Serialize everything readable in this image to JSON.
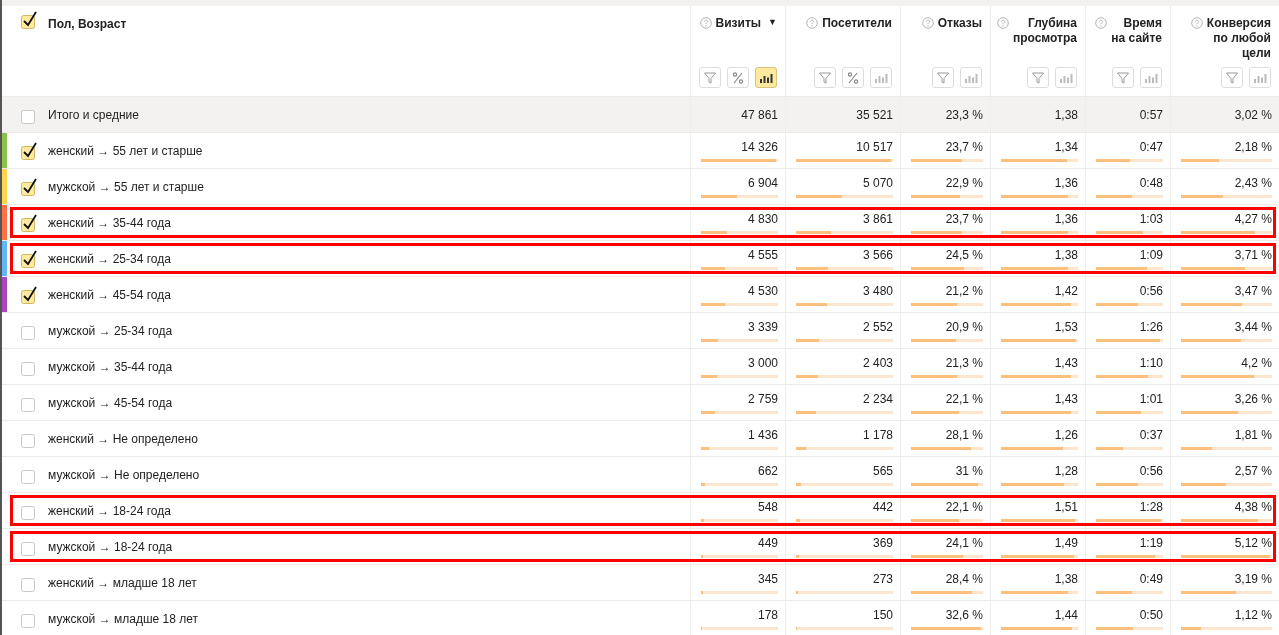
{
  "dimension": {
    "label": "Пол, Возраст",
    "checked": true
  },
  "columns": [
    {
      "title": "Визиты",
      "sort": "▼",
      "tools": [
        {
          "kind": "filter",
          "selected": false
        },
        {
          "kind": "percent",
          "selected": false
        },
        {
          "kind": "bars",
          "selected": true
        }
      ]
    },
    {
      "title": "Посетители",
      "tools": [
        {
          "kind": "filter",
          "selected": false
        },
        {
          "kind": "percent",
          "selected": false
        },
        {
          "kind": "bars",
          "selected": false
        }
      ]
    },
    {
      "title": "Отказы",
      "tools": [
        {
          "kind": "filter",
          "selected": false
        },
        {
          "kind": "bars",
          "selected": false
        }
      ]
    },
    {
      "title": "Глубина\nпросмотра",
      "tools": [
        {
          "kind": "filter",
          "selected": false
        },
        {
          "kind": "bars",
          "selected": false
        }
      ]
    },
    {
      "title": "Время\nна сайте",
      "tools": [
        {
          "kind": "filter",
          "selected": false
        },
        {
          "kind": "bars",
          "selected": false
        }
      ]
    },
    {
      "title": "Конверсия\nпо любой\nцели",
      "tools": [
        {
          "kind": "filter",
          "selected": false
        },
        {
          "kind": "bars",
          "selected": false
        }
      ]
    }
  ],
  "total": {
    "label": "Итого и средние",
    "checked": false,
    "values": [
      "47 861",
      "35 521",
      "23,3 %",
      "1,38",
      "0:57",
      "3,02 %"
    ]
  },
  "rows": [
    {
      "label": "женский → 55 лет и старше",
      "checked": true,
      "color": "#8bc34a",
      "highlighted": false,
      "cells": [
        {
          "value": "14 326",
          "level": 1
        },
        {
          "value": "10 517",
          "level": 1
        },
        {
          "value": "23,7 %",
          "level": 0.73
        },
        {
          "value": "1,34",
          "level": 0.88
        },
        {
          "value": "0:47",
          "level": 0.53
        },
        {
          "value": "2,18 %",
          "level": 0.43
        }
      ]
    },
    {
      "label": "мужской → 55 лет и старше",
      "checked": true,
      "color": "#ffd54f",
      "highlighted": false,
      "cells": [
        {
          "value": "6 904",
          "level": 0.48
        },
        {
          "value": "5 070",
          "level": 0.48
        },
        {
          "value": "22,9 %",
          "level": 0.7
        },
        {
          "value": "1,36",
          "level": 0.89
        },
        {
          "value": "0:48",
          "level": 0.55
        },
        {
          "value": "2,43 %",
          "level": 0.47
        }
      ]
    },
    {
      "label": "женский → 35-44 года",
      "checked": true,
      "color": "#ff7043",
      "highlighted": true,
      "cells": [
        {
          "value": "4 830",
          "level": 0.34
        },
        {
          "value": "3 861",
          "level": 0.37
        },
        {
          "value": "23,7 %",
          "level": 0.73
        },
        {
          "value": "1,36",
          "level": 0.89
        },
        {
          "value": "1:03",
          "level": 0.72
        },
        {
          "value": "4,27 %",
          "level": 0.83
        }
      ]
    },
    {
      "label": "женский → 25-34 года",
      "checked": true,
      "color": "#64b5f6",
      "highlighted": true,
      "cells": [
        {
          "value": "4 555",
          "level": 0.32
        },
        {
          "value": "3 566",
          "level": 0.34
        },
        {
          "value": "24,5 %",
          "level": 0.75
        },
        {
          "value": "1,38",
          "level": 0.9
        },
        {
          "value": "1:09",
          "level": 0.78
        },
        {
          "value": "3,71 %",
          "level": 0.72
        }
      ]
    },
    {
      "label": "женский → 45-54 года",
      "checked": true,
      "color": "#ab47bc",
      "highlighted": false,
      "cells": [
        {
          "value": "4 530",
          "level": 0.32
        },
        {
          "value": "3 480",
          "level": 0.33
        },
        {
          "value": "21,2 %",
          "level": 0.65
        },
        {
          "value": "1,42",
          "level": 0.93
        },
        {
          "value": "0:56",
          "level": 0.64
        },
        {
          "value": "3,47 %",
          "level": 0.68
        }
      ]
    },
    {
      "label": "мужской → 25-34 года",
      "checked": false,
      "highlighted": false,
      "cells": [
        {
          "value": "3 339",
          "level": 0.23
        },
        {
          "value": "2 552",
          "level": 0.24
        },
        {
          "value": "20,9 %",
          "level": 0.64
        },
        {
          "value": "1,53",
          "level": 1
        },
        {
          "value": "1:26",
          "level": 0.98
        },
        {
          "value": "3,44 %",
          "level": 0.67
        }
      ]
    },
    {
      "label": "мужской → 35-44 года",
      "checked": false,
      "highlighted": false,
      "cells": [
        {
          "value": "3 000",
          "level": 0.21
        },
        {
          "value": "2 403",
          "level": 0.23
        },
        {
          "value": "21,3 %",
          "level": 0.65
        },
        {
          "value": "1,43",
          "level": 0.93
        },
        {
          "value": "1:10",
          "level": 0.8
        },
        {
          "value": "4,2 %",
          "level": 0.82
        }
      ]
    },
    {
      "label": "мужской → 45-54 года",
      "checked": false,
      "highlighted": false,
      "cells": [
        {
          "value": "2 759",
          "level": 0.19
        },
        {
          "value": "2 234",
          "level": 0.21
        },
        {
          "value": "22,1 %",
          "level": 0.68
        },
        {
          "value": "1,43",
          "level": 0.93
        },
        {
          "value": "1:01",
          "level": 0.69
        },
        {
          "value": "3,26 %",
          "level": 0.64
        }
      ]
    },
    {
      "label": "женский → Не определено",
      "checked": false,
      "highlighted": false,
      "cells": [
        {
          "value": "1 436",
          "level": 0.1
        },
        {
          "value": "1 178",
          "level": 0.11
        },
        {
          "value": "28,1 %",
          "level": 0.86
        },
        {
          "value": "1,26",
          "level": 0.82
        },
        {
          "value": "0:37",
          "level": 0.42
        },
        {
          "value": "1,81 %",
          "level": 0.35
        }
      ]
    },
    {
      "label": "мужской → Не определено",
      "checked": false,
      "highlighted": false,
      "cells": [
        {
          "value": "662",
          "level": 0.05
        },
        {
          "value": "565",
          "level": 0.05
        },
        {
          "value": "31 %",
          "level": 0.95
        },
        {
          "value": "1,28",
          "level": 0.84
        },
        {
          "value": "0:56",
          "level": 0.64
        },
        {
          "value": "2,57 %",
          "level": 0.5
        }
      ]
    },
    {
      "label": "женский → 18-24 года",
      "checked": false,
      "highlighted": true,
      "cells": [
        {
          "value": "548",
          "level": 0.04
        },
        {
          "value": "442",
          "level": 0.04
        },
        {
          "value": "22,1 %",
          "level": 0.68
        },
        {
          "value": "1,51",
          "level": 0.99
        },
        {
          "value": "1:28",
          "level": 1
        },
        {
          "value": "4,38 %",
          "level": 0.86
        }
      ]
    },
    {
      "label": "мужской → 18-24 года",
      "checked": false,
      "highlighted": true,
      "cells": [
        {
          "value": "449",
          "level": 0.03
        },
        {
          "value": "369",
          "level": 0.035
        },
        {
          "value": "24,1 %",
          "level": 0.74
        },
        {
          "value": "1,49",
          "level": 0.97
        },
        {
          "value": "1:19",
          "level": 0.9
        },
        {
          "value": "5,12 %",
          "level": 1
        }
      ]
    },
    {
      "label": "женский → младше 18 лет",
      "checked": false,
      "highlighted": false,
      "cells": [
        {
          "value": "345",
          "level": 0.02
        },
        {
          "value": "273",
          "level": 0.026
        },
        {
          "value": "28,4 %",
          "level": 0.87
        },
        {
          "value": "1,38",
          "level": 0.9
        },
        {
          "value": "0:49",
          "level": 0.56
        },
        {
          "value": "3,19 %",
          "level": 0.62
        }
      ]
    },
    {
      "label": "мужской → младше 18 лет",
      "checked": false,
      "highlighted": false,
      "cells": [
        {
          "value": "178",
          "level": 0.01
        },
        {
          "value": "150",
          "level": 0.014
        },
        {
          "value": "32,6 %",
          "level": 1
        },
        {
          "value": "1,44",
          "level": 0.94
        },
        {
          "value": "0:50",
          "level": 0.57
        },
        {
          "value": "1,12 %",
          "level": 0.22
        }
      ]
    }
  ]
}
